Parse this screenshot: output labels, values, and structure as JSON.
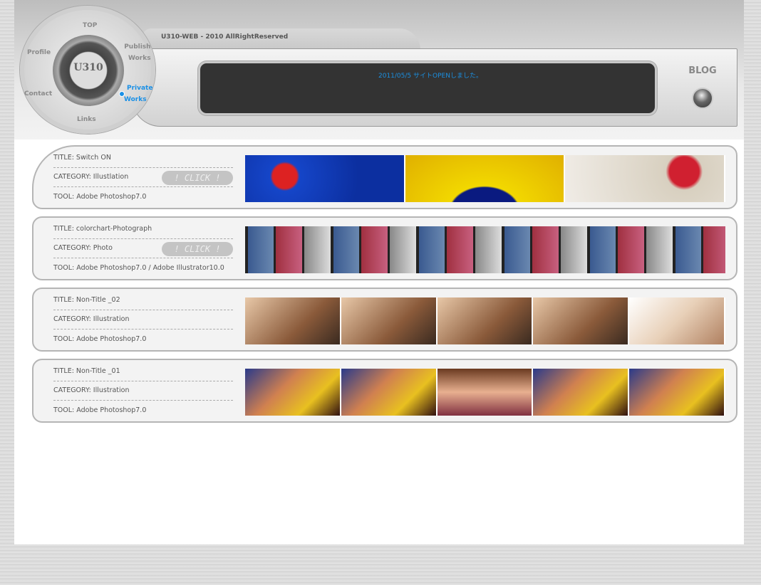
{
  "header": {
    "logo": "U310",
    "copyright": "U310-WEB - 2010 AllRightReserved",
    "news": "2011/05/5 サイトOPENしました。",
    "blog_label": "BLOG"
  },
  "nav": {
    "top": "TOP",
    "publish_1": "Publish",
    "publish_2": "Works",
    "private_1": "Private",
    "private_2": "Works",
    "profile": "Profile",
    "contact": "Contact",
    "links": "Links",
    "active_color": "#1a90e6"
  },
  "works": [
    {
      "title": "TITLE: Switch ON",
      "category": "CATEGORY: Illustlation",
      "tool": "TOOL: Adobe Photoshop7.0",
      "click": "! CLICK !"
    },
    {
      "title": "TITLE: colorchart-Photograph",
      "category": "CATEGORY: Photo",
      "tool": "TOOL:  Adobe Photoshop7.0 / Adobe Illustrator10.0",
      "click": "! CLICK !"
    },
    {
      "title": "TITLE:  Non-Title _02",
      "category": "CATEGORY: Illustration",
      "tool": "TOOL:  Adobe Photoshop7.0"
    },
    {
      "title": "TITLE:  Non-Title _01",
      "category": "CATEGORY: Illustration",
      "tool": "TOOL:  Adobe Photoshop7.0"
    }
  ]
}
